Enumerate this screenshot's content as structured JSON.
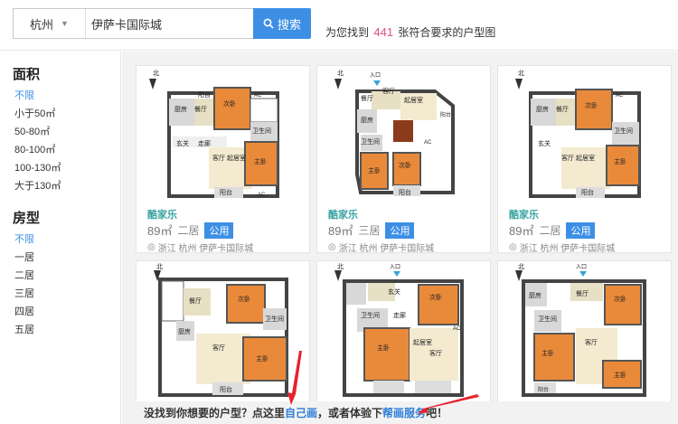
{
  "header": {
    "city": "杭州",
    "query": "伊萨卡国际城",
    "search_label": "搜索",
    "result_prefix": "为您找到",
    "result_count": "441",
    "result_suffix": "张符合要求的户型图"
  },
  "sidebar": {
    "area_title": "面积",
    "area_items": [
      "不限",
      "小于50㎡",
      "50-80㎡",
      "80-100㎡",
      "100-130㎡",
      "大于130㎡"
    ],
    "type_title": "房型",
    "type_items": [
      "不限",
      "一居",
      "二居",
      "三居",
      "四居",
      "五居"
    ]
  },
  "cards": [
    {
      "brand": "酷家乐",
      "area": "89㎡",
      "rooms": "二居",
      "tag": "公用",
      "location": "浙江 杭州  伊萨卡国际城"
    },
    {
      "brand": "酷家乐",
      "area": "89㎡",
      "rooms": "三居",
      "tag": "公用",
      "location": "浙江 杭州  伊萨卡国际城"
    },
    {
      "brand": "酷家乐",
      "area": "89㎡",
      "rooms": "二居",
      "tag": "公用",
      "location": "浙江 杭州  伊萨卡国际城"
    },
    {},
    {},
    {}
  ],
  "plan_labels": {
    "north": "北",
    "entrance": "入口",
    "balcony": "阳台",
    "bedroom": "次卧",
    "master": "主卧",
    "kitchen": "厨房",
    "dining": "餐厅",
    "bath": "卫生间",
    "hall": "走廊",
    "living": "客厅",
    "living_dining": "客厅  起居室",
    "living2": "起居室",
    "foyer": "玄关",
    "ac": "AC"
  },
  "footer": {
    "text1": "没找到你想要的户型？点这里",
    "link1": "自己画",
    "text2": "，或者体验下",
    "link2": "帮画服务",
    "text3": "吧！"
  },
  "colors": {
    "accent": "#3d8fe6",
    "count": "#e0507a",
    "brand": "#3aa3a3",
    "arrow": "#e8222e"
  }
}
